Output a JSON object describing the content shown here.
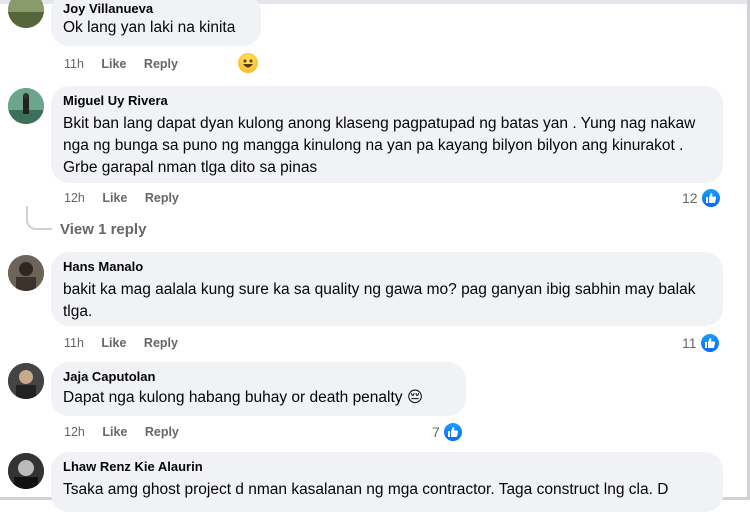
{
  "comments": [
    {
      "name": "Joy Villanueva",
      "text": "Ok lang yan laki na kinita",
      "time": "11h",
      "like_label": "Like",
      "reply_label": "Reply",
      "reaction": "haha-emoji-icon"
    },
    {
      "name": "Miguel Uy Rivera",
      "text": "Bkit ban lang dapat dyan kulong anong klaseng pagpatupad ng batas yan . Yung nag nakaw nga ng bunga sa puno ng mangga kinulong na yan pa kayang bilyon bilyon ang kinurakot . Grbe garapal nman tlga dito sa pinas",
      "time": "12h",
      "like_label": "Like",
      "reply_label": "Reply",
      "reaction_count": "12",
      "view_replies": "View 1 reply"
    },
    {
      "name": "Hans Manalo",
      "text": "bakit ka mag aalala kung sure ka sa quality ng gawa mo? pag ganyan ibig sabhin may balak tlga.",
      "time": "11h",
      "like_label": "Like",
      "reply_label": "Reply",
      "reaction_count": "11"
    },
    {
      "name": "Jaja Caputolan",
      "text": "Dapat nga kulong habang buhay or death penalty 😔",
      "time": "12h",
      "like_label": "Like",
      "reply_label": "Reply",
      "reaction_count": "7"
    },
    {
      "name": "Lhaw Renz Kie Alaurin",
      "text": "Tsaka amg ghost project d nman kasalanan ng mga contractor. Taga construct lng cla. D"
    }
  ],
  "colors": {
    "bubble": "#f0f2f5",
    "meta": "#65676b",
    "like_blue": "#0866ff"
  }
}
